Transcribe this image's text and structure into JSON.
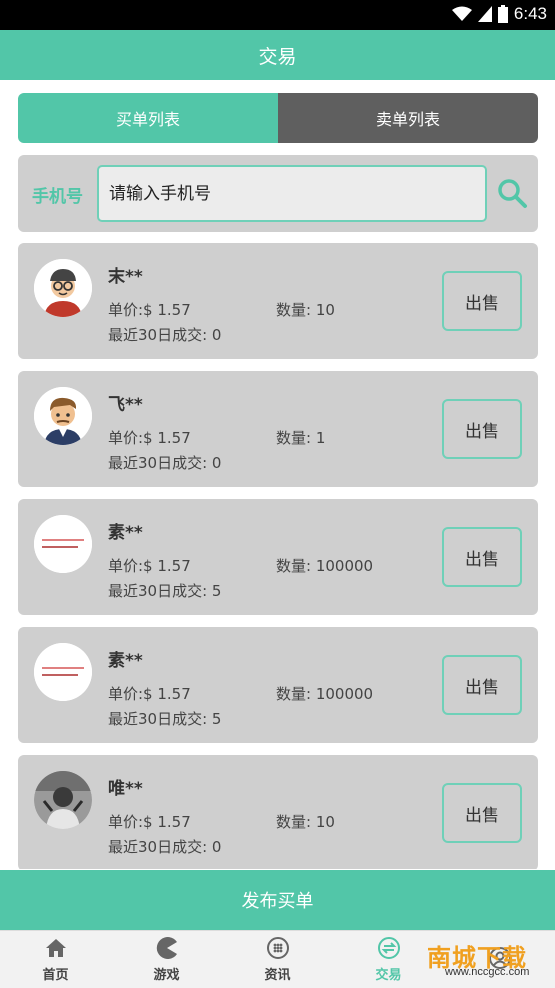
{
  "status_bar": {
    "time": "6:43"
  },
  "header": {
    "title": "交易"
  },
  "tabs": [
    {
      "label": "买单列表",
      "active": true
    },
    {
      "label": "卖单列表",
      "active": false
    }
  ],
  "search": {
    "label": "手机号",
    "placeholder": "请输入手机号",
    "value": ""
  },
  "orders": [
    {
      "name": "末**",
      "price": "单价:$ 1.57",
      "quantity": "数量: 10",
      "recent": "最近30日成交: 0",
      "button": "出售",
      "avatar": "glasses-man-avatar"
    },
    {
      "name": "飞**",
      "price": "单价:$ 1.57",
      "quantity": "数量: 1",
      "recent": "最近30日成交: 0",
      "button": "出售",
      "avatar": "man-avatar"
    },
    {
      "name": "素**",
      "price": "单价:$ 1.57",
      "quantity": "数量: 100000",
      "recent": "最近30日成交: 5",
      "button": "出售",
      "avatar": "text-avatar"
    },
    {
      "name": "素**",
      "price": "单价:$ 1.57",
      "quantity": "数量: 100000",
      "recent": "最近30日成交: 5",
      "button": "出售",
      "avatar": "text-avatar"
    },
    {
      "name": "唯**",
      "price": "单价:$ 1.57",
      "quantity": "数量: 10",
      "recent": "最近30日成交: 0",
      "button": "出售",
      "avatar": "photo-avatar"
    }
  ],
  "publish_button": "发布买单",
  "bottom_nav": [
    {
      "label": "首页",
      "icon": "home-icon",
      "active": false
    },
    {
      "label": "游戏",
      "icon": "pacman-icon",
      "active": false
    },
    {
      "label": "资讯",
      "icon": "grid-circle-icon",
      "active": false
    },
    {
      "label": "交易",
      "icon": "exchange-icon",
      "active": true
    },
    {
      "label": "",
      "icon": "user-icon",
      "active": false
    }
  ],
  "watermark": {
    "text": "南城下载",
    "sub": "www.nccgcc.com"
  },
  "colors": {
    "accent": "#52c6a8",
    "tab_inactive": "#5f5f5f",
    "card_bg": "#cfcfcf"
  }
}
